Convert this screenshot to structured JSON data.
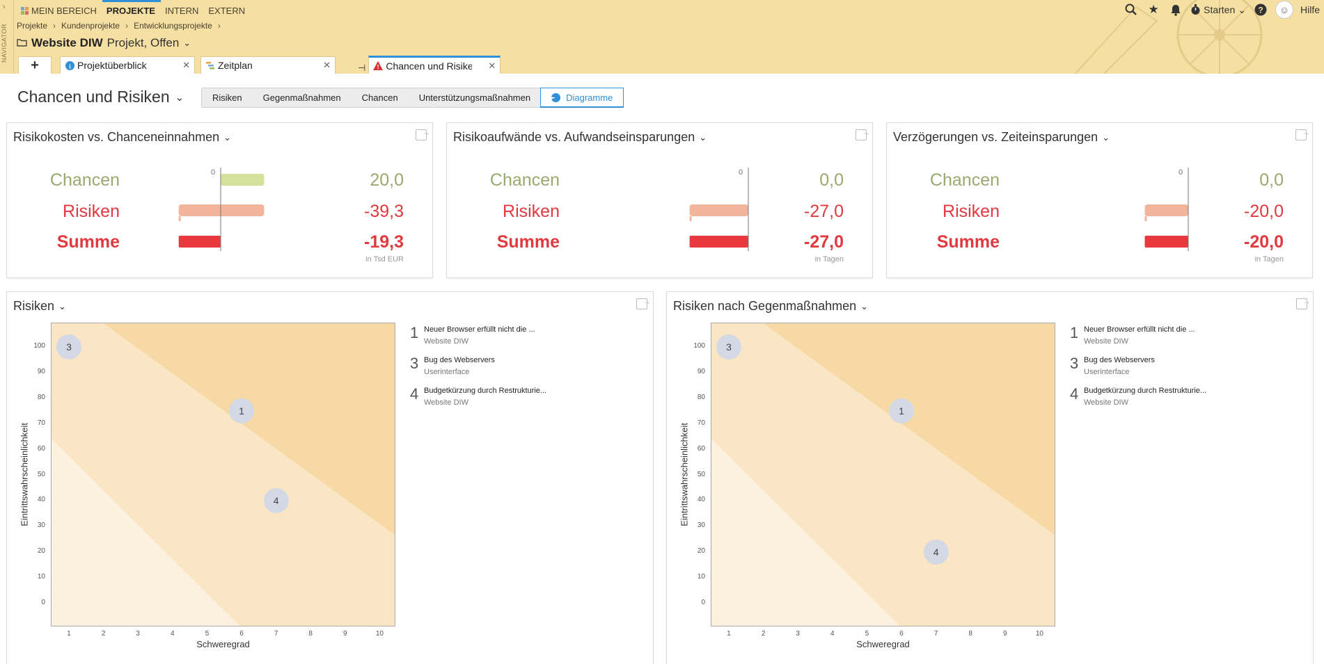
{
  "nav": {
    "navigator_label": "NAVIGATOR",
    "items": [
      "MEIN BEREICH",
      "PROJEKTE",
      "INTERN",
      "EXTERN"
    ],
    "active": "PROJEKTE",
    "starten": "Starten",
    "help": "Hilfe"
  },
  "breadcrumb": [
    "Projekte",
    "Kundenprojekte",
    "Entwicklungsprojekte"
  ],
  "project": {
    "name": "Website DIW",
    "status": "Projekt, Offen"
  },
  "tabs": [
    {
      "label": "Projektüberblick"
    },
    {
      "label": "Zeitplan"
    },
    {
      "label": "Chancen und Risiken"
    }
  ],
  "page": {
    "title": "Chancen und Risiken",
    "segments": [
      "Risiken",
      "Gegenmaßnahmen",
      "Chancen",
      "Unterstützungsmaßnahmen",
      "Diagramme"
    ],
    "active_segment": "Diagramme"
  },
  "comparison_panels": [
    {
      "title": "Risikokosten vs. Chanceneinnahmen",
      "labels": {
        "chancen": "Chancen",
        "risiken": "Risiken",
        "summe": "Summe"
      },
      "zero_label": "0",
      "chancen_value": "20,0",
      "risiken_value": "-39,3",
      "summe_value": "-19,3",
      "unit": "in Tsd EUR",
      "values": {
        "chancen": 20.0,
        "risiken": -39.3,
        "summe": -19.3
      }
    },
    {
      "title": "Risikoaufwände vs. Aufwandseinsparungen",
      "labels": {
        "chancen": "Chancen",
        "risiken": "Risiken",
        "summe": "Summe"
      },
      "zero_label": "0",
      "chancen_value": "0,0",
      "risiken_value": "-27,0",
      "summe_value": "-27,0",
      "unit": "in Tagen",
      "values": {
        "chancen": 0.0,
        "risiken": -27.0,
        "summe": -27.0
      }
    },
    {
      "title": "Verzögerungen vs. Zeiteinsparungen",
      "labels": {
        "chancen": "Chancen",
        "risiken": "Risiken",
        "summe": "Summe"
      },
      "zero_label": "0",
      "chancen_value": "0,0",
      "risiken_value": "-20,0",
      "summe_value": "-20,0",
      "unit": "in Tagen",
      "values": {
        "chancen": 0.0,
        "risiken": -20.0,
        "summe": -20.0
      }
    }
  ],
  "matrix_panels": [
    {
      "title": "Risiken",
      "xlabel": "Schweregrad",
      "ylabel": "Eintrittswahrscheinlichkeit",
      "x_ticks": [
        "1",
        "2",
        "3",
        "4",
        "5",
        "6",
        "7",
        "8",
        "9",
        "10"
      ],
      "y_ticks": [
        "100",
        "90",
        "80",
        "70",
        "60",
        "50",
        "40",
        "30",
        "20",
        "10",
        "0"
      ],
      "points": [
        {
          "id": "3",
          "x": 1,
          "y": 100
        },
        {
          "id": "1",
          "x": 6,
          "y": 75
        },
        {
          "id": "4",
          "x": 7,
          "y": 40
        }
      ],
      "risks": [
        {
          "num": "1",
          "title": "Neuer Browser erfüllt nicht die ...",
          "sub": "Website DIW"
        },
        {
          "num": "3",
          "title": "Bug des Webservers",
          "sub": "Userinterface"
        },
        {
          "num": "4",
          "title": "Budgetkürzung durch Restrukturie...",
          "sub": "Website DIW"
        }
      ]
    },
    {
      "title": "Risiken nach Gegenmaßnahmen",
      "xlabel": "Schweregrad",
      "ylabel": "Eintrittswahrscheinlichkeit",
      "x_ticks": [
        "1",
        "2",
        "3",
        "4",
        "5",
        "6",
        "7",
        "8",
        "9",
        "10"
      ],
      "y_ticks": [
        "100",
        "90",
        "80",
        "70",
        "60",
        "50",
        "40",
        "30",
        "20",
        "10",
        "0"
      ],
      "points": [
        {
          "id": "3",
          "x": 1,
          "y": 100
        },
        {
          "id": "1",
          "x": 6,
          "y": 75
        },
        {
          "id": "4",
          "x": 7,
          "y": 20
        }
      ],
      "risks": [
        {
          "num": "1",
          "title": "Neuer Browser erfüllt nicht die ...",
          "sub": "Website DIW"
        },
        {
          "num": "3",
          "title": "Bug des Webservers",
          "sub": "Userinterface"
        },
        {
          "num": "4",
          "title": "Budgetkürzung durch Restrukturie...",
          "sub": "Website DIW"
        }
      ]
    }
  ],
  "colors": {
    "header_bg": "#f5dfa3",
    "accent": "#2f8fd8",
    "chancen_bar": "#d3e19a",
    "risiken_bar": "#f2b59b",
    "summe_bar": "#e8393e",
    "zone_high": "#f7d9a6",
    "zone_mid": "#fae6c4",
    "zone_low": "#fcf1de"
  }
}
